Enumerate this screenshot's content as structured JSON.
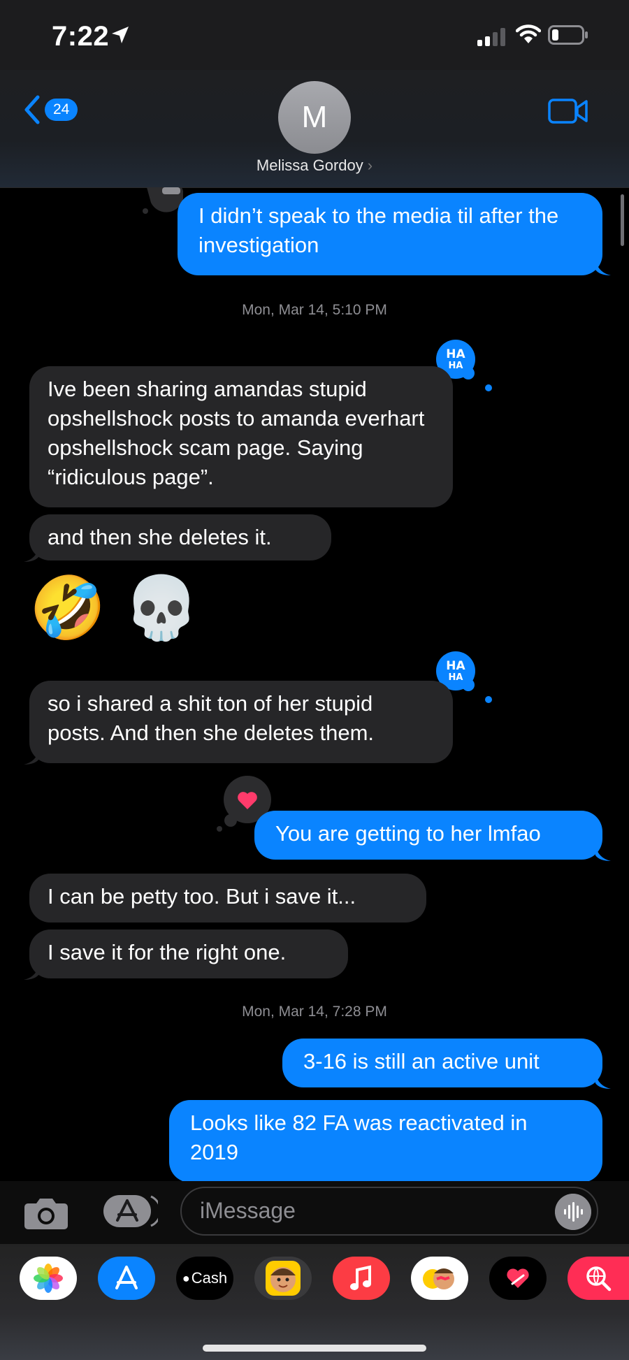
{
  "status": {
    "time": "7:22"
  },
  "header": {
    "back_count": "24",
    "avatar_initial": "M",
    "contact_name": "Melissa Gordoy"
  },
  "messages": {
    "m1": "I didn’t speak to the media til after the investigation",
    "ts1": "Mon, Mar 14, 5:10 PM",
    "m2": "Ive been sharing amandas stupid opshellshock posts to amanda everhart opshellshock scam page. Saying “ridiculous page”.",
    "m3": "and then she deletes it.",
    "m4_emojis": "🤣 💀",
    "m5": "so i shared a shit ton of her stupid posts. And then she deletes them.",
    "m6": "You are getting to her lmfao",
    "m7": "I can be petty too. But i save it...",
    "m8": "I save it for the right one.",
    "ts2": "Mon, Mar 14, 7:28 PM",
    "m9": "3-16 is still an active unit",
    "m10": "Looks like 82 FA was reactivated in 2019"
  },
  "tapbacks": {
    "haha": "HA HA"
  },
  "input": {
    "placeholder": "iMessage"
  },
  "drawer": {
    "cash_label": "Cash"
  },
  "colors": {
    "sent": "#0a84ff",
    "received": "#262628",
    "background": "#000000"
  }
}
